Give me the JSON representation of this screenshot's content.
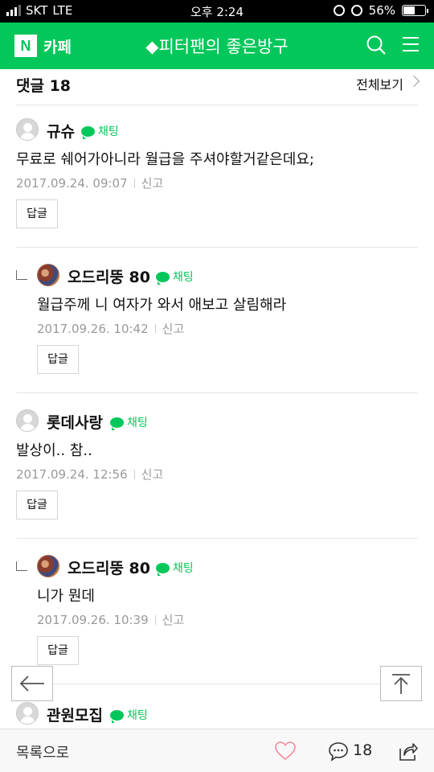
{
  "status_bar": {
    "carrier": "SKT",
    "network": "LTE",
    "time": "오후 2:24",
    "battery_text": "56%",
    "battery_level": 0.56
  },
  "app_bar": {
    "logo": "N",
    "cafe_label": "카페",
    "title": "◆피터팬의 좋은방구",
    "accent_color": "#03c75a",
    "icons": [
      "search-icon",
      "menu-icon"
    ]
  },
  "comments_header": {
    "title": "댓글 18",
    "view_all": "전체보기"
  },
  "comments": [
    {
      "author": "규슈",
      "chat_label": "채팅",
      "text": "무료로 쉐어가아니라 월급을 주셔야할거같은데요;",
      "date": "2017.09.24. 09:07",
      "report": "신고",
      "reply_label": "답글",
      "is_reply": false
    },
    {
      "author": "오드리뚱 80",
      "chat_label": "채팅",
      "text": "월급주께 니 여자가 와서 애보고 살림해라",
      "date": "2017.09.26. 10:42",
      "report": "신고",
      "reply_label": "답글",
      "is_reply": true
    },
    {
      "author": "롯데사랑",
      "chat_label": "채팅",
      "text": "발상이.. 참..",
      "date": "2017.09.24. 12:56",
      "report": "신고",
      "reply_label": "답글",
      "is_reply": false
    },
    {
      "author": "오드리뚱 80",
      "chat_label": "채팅",
      "text": "니가 뭔데",
      "date": "2017.09.26. 10:39",
      "report": "신고",
      "reply_label": "답글",
      "is_reply": true
    },
    {
      "author": "관원모집",
      "chat_label": "채팅",
      "is_reply": false
    }
  ],
  "bottom_bar": {
    "list_label": "목록으로",
    "comment_count": "18",
    "icons": [
      "heart-icon",
      "comment-icon",
      "share-icon"
    ]
  },
  "floating": {
    "icons": [
      "back-arrow-icon",
      "scroll-top-icon"
    ]
  }
}
